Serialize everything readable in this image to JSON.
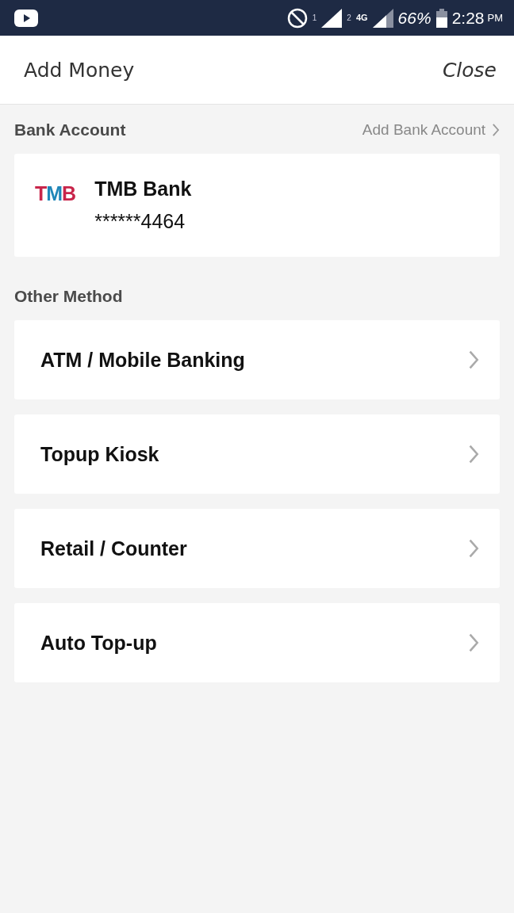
{
  "status_bar": {
    "sim1": "1",
    "sim2": "2",
    "network": "4G",
    "battery": "66%",
    "time": "2:28",
    "ampm": "PM"
  },
  "header": {
    "title": "Add Money",
    "close": "Close"
  },
  "bank_section": {
    "title": "Bank Account",
    "action": "Add Bank Account",
    "account": {
      "logo": [
        {
          "text": "T",
          "color": "#c8254a"
        },
        {
          "text": "M",
          "color": "#1f86b8"
        },
        {
          "text": "B",
          "color": "#c8254a"
        }
      ],
      "name": "TMB Bank",
      "number": "******4464"
    }
  },
  "other_section": {
    "title": "Other Method",
    "items": [
      {
        "label": "ATM / Mobile Banking"
      },
      {
        "label": "Topup Kiosk"
      },
      {
        "label": "Retail / Counter"
      },
      {
        "label": "Auto Top-up"
      }
    ]
  }
}
